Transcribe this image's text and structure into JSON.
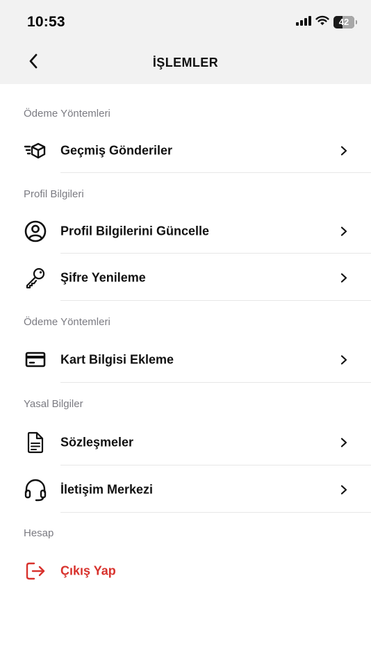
{
  "status_bar": {
    "time": "10:53",
    "battery": "42",
    "battery_level": 0.42
  },
  "nav": {
    "title": "İŞLEMLER",
    "back_icon": "chevron-left-icon"
  },
  "sections": [
    {
      "title": "Ödeme Yöntemleri",
      "items": [
        {
          "label": "Geçmiş Gönderiler",
          "icon": "fast-box-icon"
        }
      ]
    },
    {
      "title": "Profil Bilgileri",
      "items": [
        {
          "label": "Profil Bilgilerini Güncelle",
          "icon": "user-circle-icon"
        },
        {
          "label": "Şifre Yenileme",
          "icon": "key-icon"
        }
      ]
    },
    {
      "title": "Ödeme Yöntemleri",
      "items": [
        {
          "label": "Kart Bilgisi Ekleme",
          "icon": "credit-card-icon"
        }
      ]
    },
    {
      "title": "Yasal Bilgiler",
      "items": [
        {
          "label": "Sözleşmeler",
          "icon": "document-icon"
        },
        {
          "label": "İletişim Merkezi",
          "icon": "headset-icon"
        }
      ]
    },
    {
      "title": "Hesap",
      "items": [
        {
          "label": "Çıkış Yap",
          "icon": "logout-icon",
          "color": "#d8322d"
        }
      ]
    }
  ],
  "colors": {
    "header_bg": "#f2f2f2",
    "section_title": "#7b7b82",
    "danger": "#d8322d",
    "text": "#111111"
  }
}
